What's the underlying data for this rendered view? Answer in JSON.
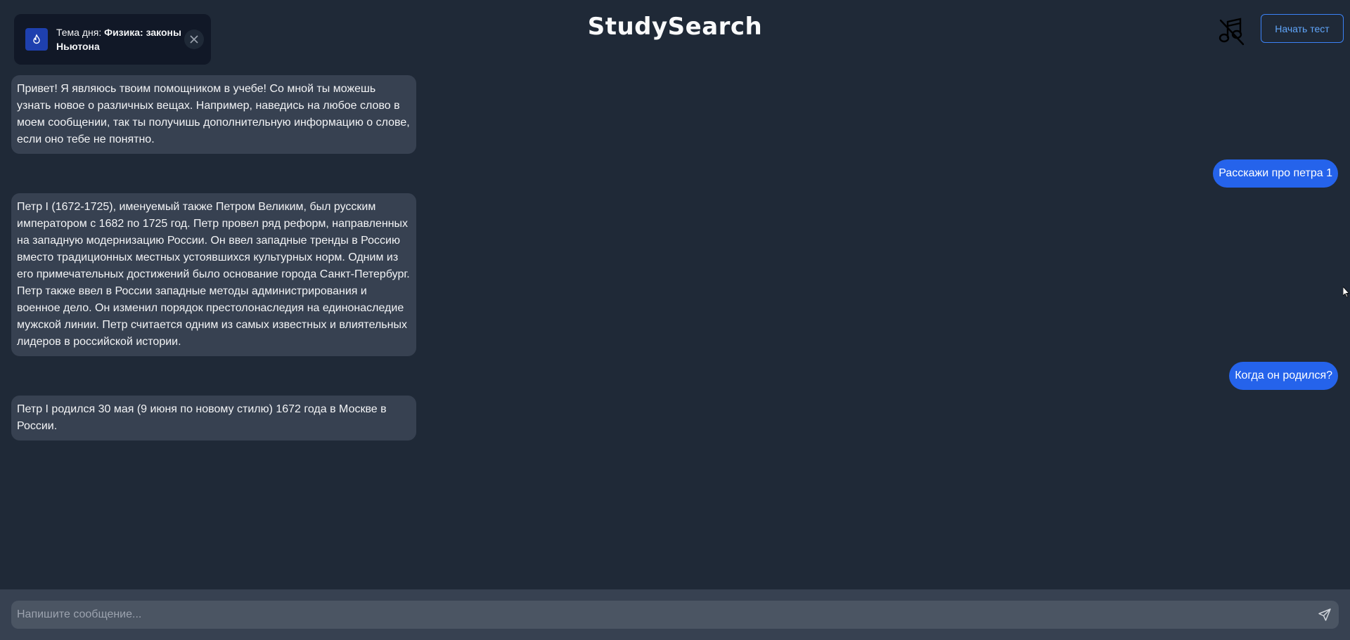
{
  "app": {
    "title": "StudySearch"
  },
  "topic_of_day": {
    "prefix": "Тема дня: ",
    "topic": "Физика: законы Ньютона",
    "icon": "flame-icon"
  },
  "header": {
    "music_icon": "music-off-icon",
    "start_test_label": "Начать тест"
  },
  "messages": [
    {
      "role": "assistant",
      "text": "Привет! Я являюсь твоим помощником в учебе! Со мной ты можешь узнать новое о различных вещах. Например, наведись на любое слово в моем сообщении, так ты получишь дополнительную информацию о слове, если оно тебе не понятно."
    },
    {
      "role": "user",
      "text": "Расскажи про петра 1"
    },
    {
      "role": "assistant",
      "text": "Петр I (1672-1725), именуемый также Петром Великим, был русским императором с 1682 по 1725 год. Петр провел ряд реформ, направленных на западную модернизацию России. Он ввел западные тренды в Россию вместо традиционных местных устоявшихся культурных норм. Одним из его примечательных достижений было основание города Санкт-Петербург. Петр также ввел в России западные методы администрирования и военное дело. Он изменил порядок престолонаследия на единонаследие мужской линии. Петр считается одним из самых известных и влиятельных лидеров в российской истории."
    },
    {
      "role": "user",
      "text": "Когда он родился?"
    },
    {
      "role": "assistant",
      "text": "Петр I родился 30 мая (9 июня по новому стилю) 1672 года в Москве в России."
    }
  ],
  "composer": {
    "placeholder": "Напишите сообщение...",
    "send_icon": "send-icon"
  },
  "colors": {
    "background": "#1f2937",
    "bot_bubble": "#374151",
    "user_bubble": "#2563eb",
    "accent": "#3b82f6"
  }
}
